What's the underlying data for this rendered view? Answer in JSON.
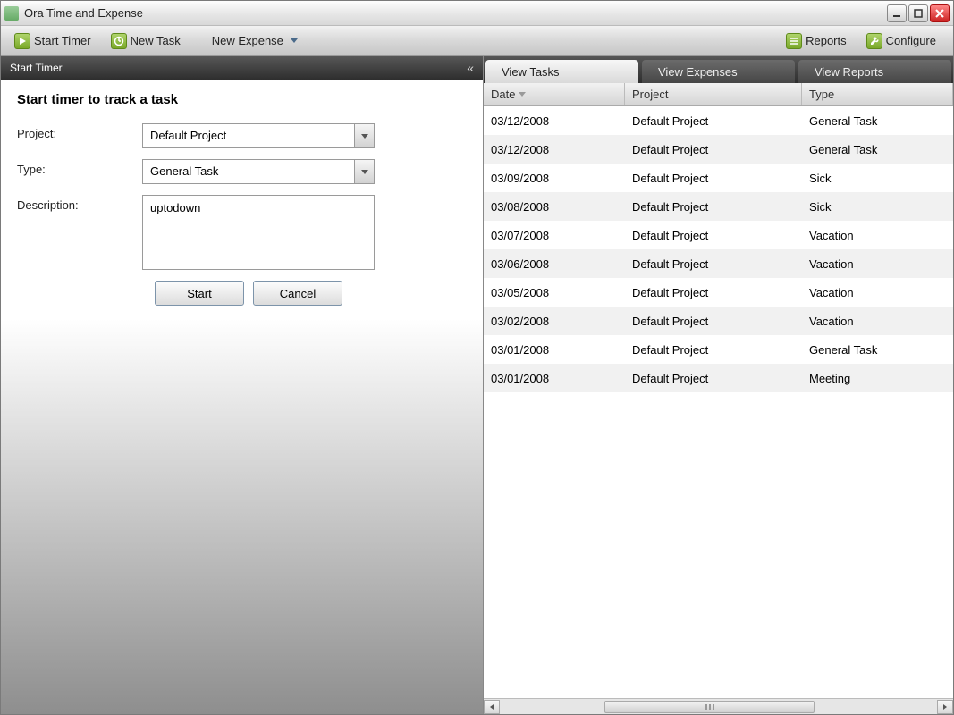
{
  "window": {
    "title": "Ora Time and Expense"
  },
  "toolbar": {
    "start_timer": "Start Timer",
    "new_task": "New Task",
    "new_expense": "New Expense",
    "reports": "Reports",
    "configure": "Configure"
  },
  "left": {
    "header": "Start Timer",
    "title": "Start timer to track a task",
    "labels": {
      "project": "Project:",
      "type": "Type:",
      "description": "Description:"
    },
    "values": {
      "project": "Default Project",
      "type": "General Task",
      "description": "uptodown"
    },
    "buttons": {
      "start": "Start",
      "cancel": "Cancel"
    }
  },
  "right": {
    "tabs": {
      "tasks": "View Tasks",
      "expenses": "View Expenses",
      "reports": "View Reports"
    },
    "columns": {
      "date": "Date",
      "project": "Project",
      "type": "Type"
    },
    "rows": [
      {
        "date": "03/12/2008",
        "project": "Default Project",
        "type": "General Task"
      },
      {
        "date": "03/12/2008",
        "project": "Default Project",
        "type": "General Task"
      },
      {
        "date": "03/09/2008",
        "project": "Default Project",
        "type": "Sick"
      },
      {
        "date": "03/08/2008",
        "project": "Default Project",
        "type": "Sick"
      },
      {
        "date": "03/07/2008",
        "project": "Default Project",
        "type": "Vacation"
      },
      {
        "date": "03/06/2008",
        "project": "Default Project",
        "type": "Vacation"
      },
      {
        "date": "03/05/2008",
        "project": "Default Project",
        "type": "Vacation"
      },
      {
        "date": "03/02/2008",
        "project": "Default Project",
        "type": "Vacation"
      },
      {
        "date": "03/01/2008",
        "project": "Default Project",
        "type": "General Task"
      },
      {
        "date": "03/01/2008",
        "project": "Default Project",
        "type": "Meeting"
      }
    ]
  }
}
